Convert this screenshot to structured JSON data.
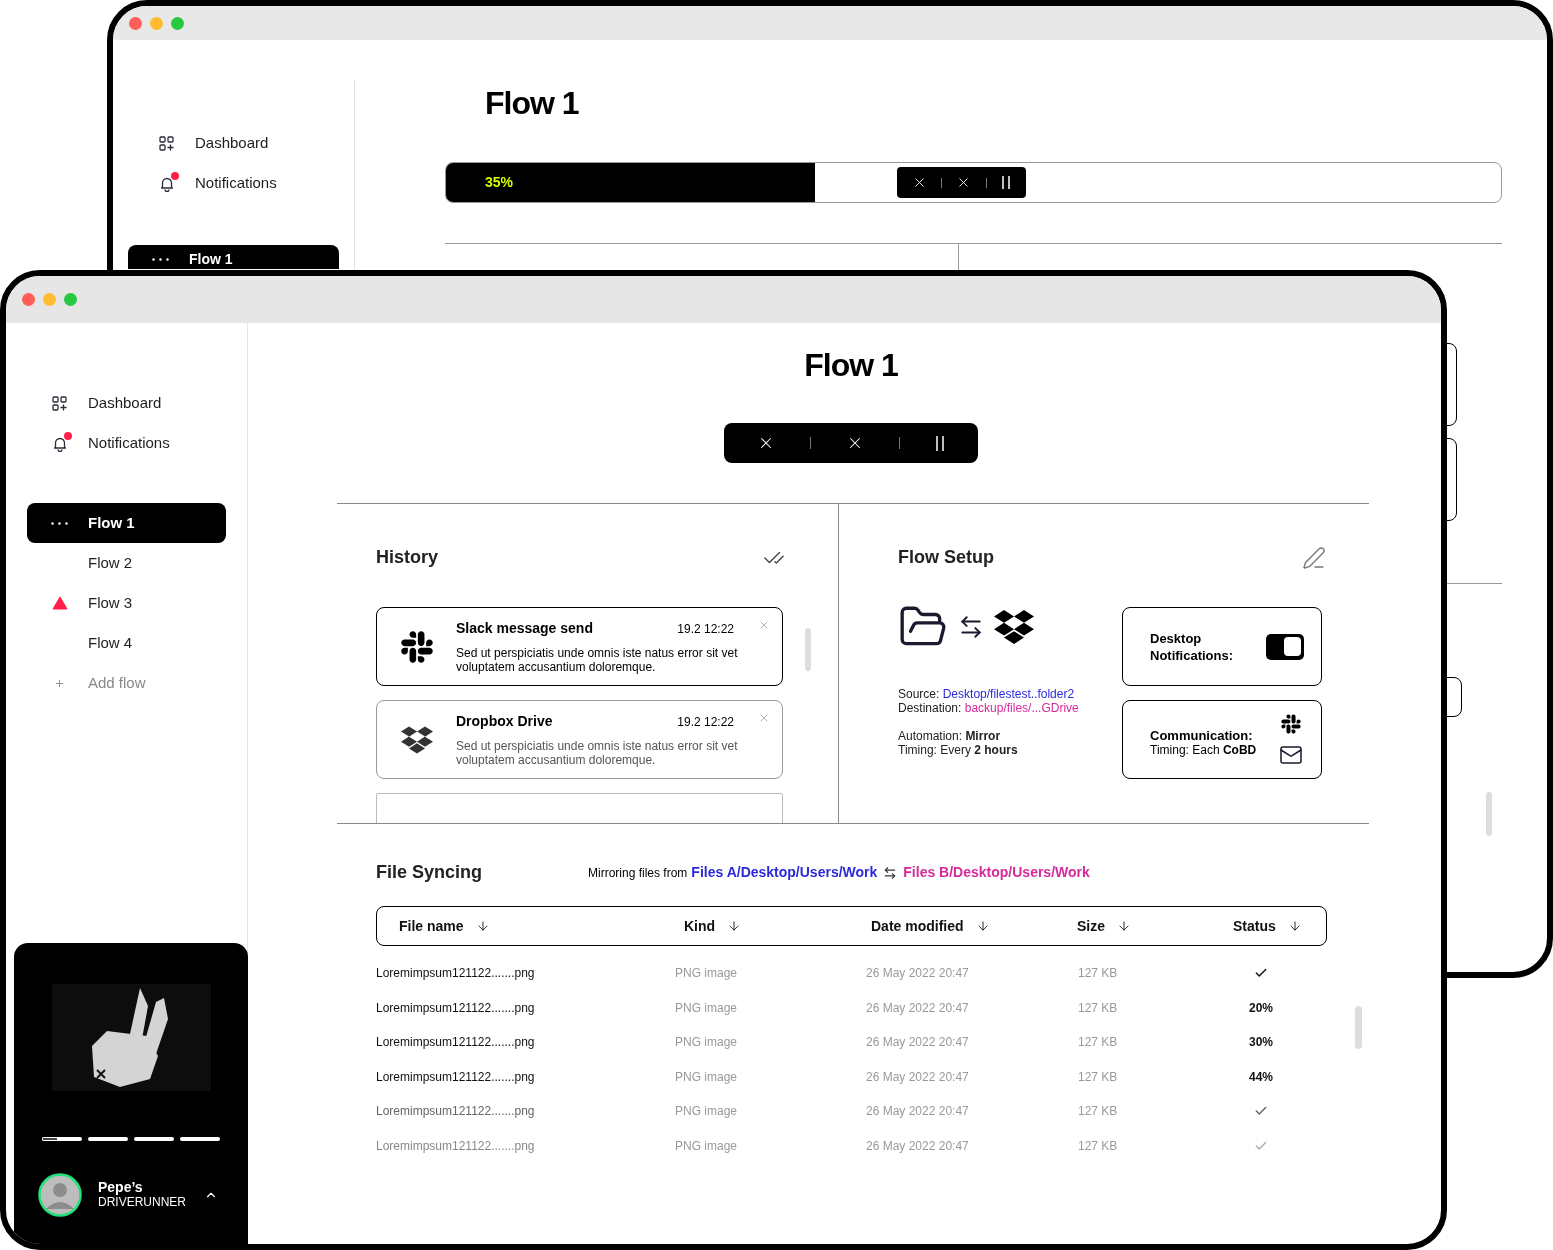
{
  "back_window": {
    "sidebar": {
      "items": [
        {
          "label": "Dashboard",
          "kind": "dashboard"
        },
        {
          "label": "Notifications",
          "kind": "notifications",
          "unread": true
        }
      ],
      "flows": [
        {
          "label": "Flow 1",
          "selected": true
        }
      ]
    },
    "title": "Flow 1",
    "progress": {
      "level": 0.35,
      "label": "35%"
    }
  },
  "window": {
    "sidebar": {
      "items": [
        {
          "label": "Dashboard",
          "kind": "dashboard"
        },
        {
          "label": "Notifications",
          "kind": "notifications",
          "unread": true
        }
      ],
      "flows": [
        {
          "label": "Flow 1",
          "selected": true,
          "warning": false
        },
        {
          "label": "Flow 2",
          "selected": false,
          "warning": false
        },
        {
          "label": "Flow 3",
          "selected": false,
          "warning": true
        },
        {
          "label": "Flow 4",
          "selected": false,
          "warning": false
        }
      ],
      "add_flow": "Add flow",
      "slides": [
        {
          "selected": true
        },
        {
          "selected": false
        },
        {
          "selected": false
        },
        {
          "selected": false
        }
      ],
      "user": {
        "name": "Pepe’s",
        "subtitle": "DRIVERUNNER"
      }
    },
    "title": "Flow 1",
    "history": {
      "title": "History",
      "items": [
        {
          "kind": "slack",
          "title": "Slack message send",
          "time": "19.2 12:22",
          "text": "Sed ut perspiciatis unde omnis iste natus error sit vet voluptatem accusantium doloremque.",
          "unread": true
        },
        {
          "kind": "dropbox",
          "title": "Dropbox Drive",
          "time": "19.2 12:22",
          "text": "Sed ut perspiciatis unde omnis iste natus error sit vet voluptatem accusantium doloremque.",
          "unread": false
        }
      ]
    },
    "flow_setup": {
      "title": "Flow Setup",
      "source_label": "Source:",
      "source": "Desktop/filestest..folder2",
      "destination_label": "Destination:",
      "destination": "backup/files/...GDrive",
      "automation": "Automation: **Mirror**",
      "timing": "Timing: Every **2 hours**",
      "desktop_notifications": {
        "label": "Desktop Notifications:",
        "on": true
      },
      "communication": {
        "label": "Communication:",
        "timing": "Timing: Each **CoBD**"
      }
    },
    "file_syncing": {
      "title": "File Syncing",
      "mirroring_label": "Mirroring files from",
      "from": "Files A/Desktop/Users/Work",
      "to": "Files B/Desktop/Users/Work",
      "columns": [
        "File name",
        "Kind",
        "Date modified",
        "Size",
        "Status"
      ],
      "rows": [
        {
          "name": "Loremimpsum121122.......png",
          "kind": "PNG image",
          "date": "26 May 2022 20:47",
          "size": "127 KB",
          "status": {
            "kind": "done"
          }
        },
        {
          "name": "Loremimpsum121122.......png",
          "kind": "PNG image",
          "date": "26 May 2022 20:47",
          "size": "127 KB",
          "status": {
            "kind": "progress",
            "text": "20%"
          }
        },
        {
          "name": "Loremimpsum121122.......png",
          "kind": "PNG image",
          "date": "26 May 2022 20:47",
          "size": "127 KB",
          "status": {
            "kind": "progress",
            "text": "30%"
          }
        },
        {
          "name": "Loremimpsum121122.......png",
          "kind": "PNG image",
          "date": "26 May 2022 20:47",
          "size": "127 KB",
          "status": {
            "kind": "progress",
            "text": "44%"
          }
        },
        {
          "name": "Loremimpsum121122.......png",
          "kind": "PNG image",
          "date": "26 May 2022 20:47",
          "size": "127 KB",
          "status": {
            "kind": "done"
          }
        },
        {
          "name": "Loremimpsum121122.......png",
          "kind": "PNG image",
          "date": "26 May 2022 20:47",
          "size": "127 KB",
          "status": {
            "kind": "done"
          }
        }
      ]
    }
  }
}
